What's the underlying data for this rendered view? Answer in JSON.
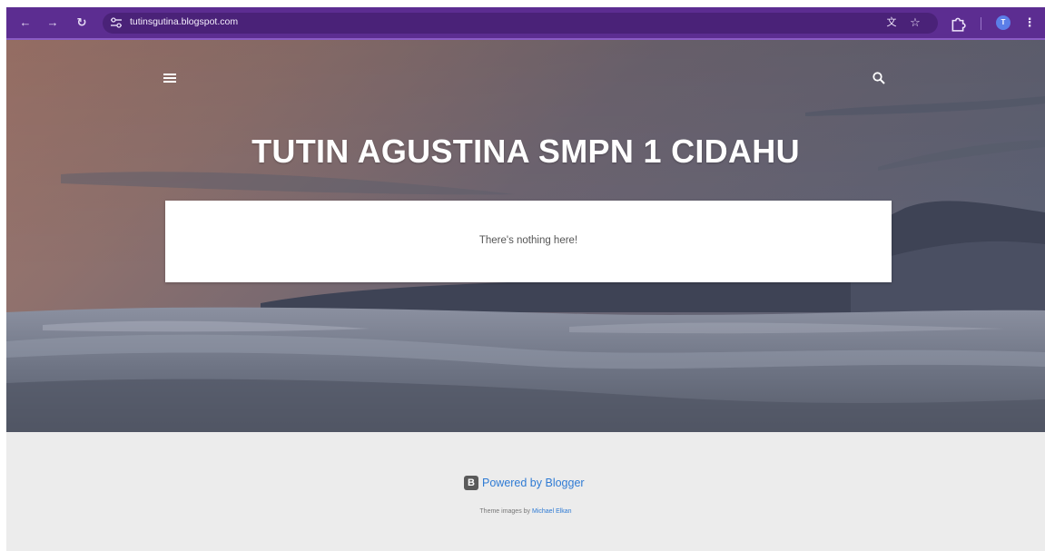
{
  "browser": {
    "url": "tutinsgutina.blogspot.com",
    "profile_initial": "T",
    "theme_color": "#5c2d91"
  },
  "icons": {
    "back": "arrow-left-icon",
    "forward": "arrow-right-icon",
    "reload": "reload-icon",
    "site_settings": "tune-icon",
    "translate": "translate-icon",
    "bookmark": "star-icon",
    "extensions": "puzzle-icon",
    "menu": "hamburger-menu-icon",
    "search": "search-icon",
    "kebab": "more-vertical-icon",
    "blogger": "blogger-icon"
  },
  "blog": {
    "title": "TUTIN AGUSTINA SMPN 1 CIDAHU",
    "empty_message": "There's nothing here!"
  },
  "footer": {
    "powered_by": "Powered by Blogger",
    "blogger_letter": "B",
    "credit_prefix": "Theme images by ",
    "credit_author": "Michael Elkan",
    "link_color": "#2f7bd4"
  }
}
